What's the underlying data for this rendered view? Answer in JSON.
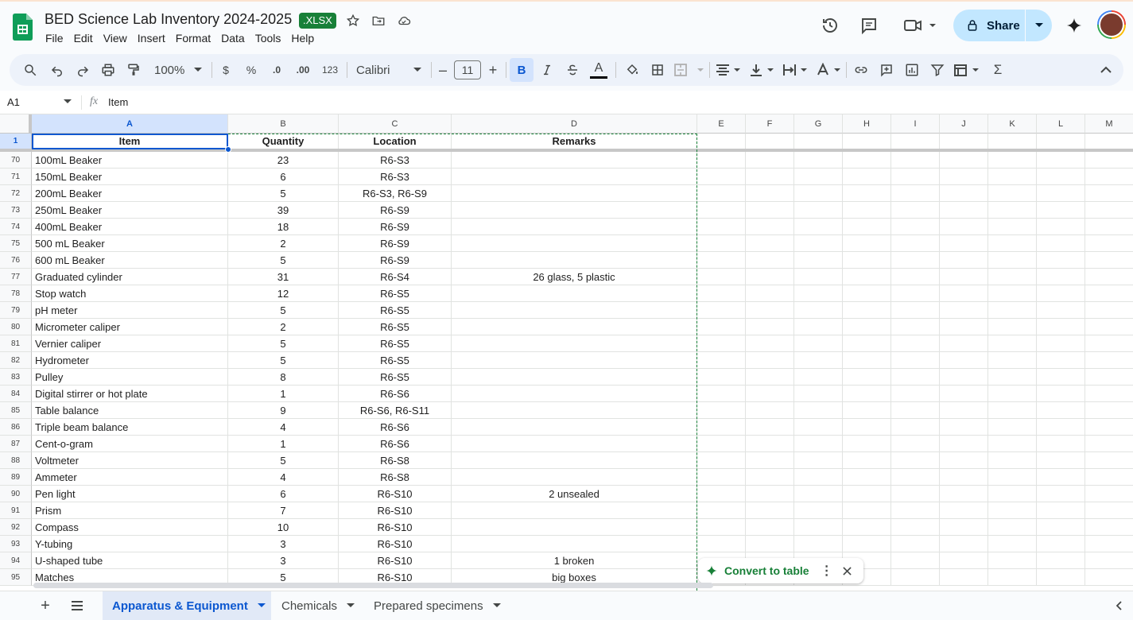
{
  "doc": {
    "title": "BED Science Lab Inventory 2024-2025",
    "badge": ".XLSX"
  },
  "menu": [
    "File",
    "Edit",
    "View",
    "Insert",
    "Format",
    "Data",
    "Tools",
    "Help"
  ],
  "share_label": "Share",
  "toolbar": {
    "zoom": "100%",
    "currency": "$",
    "percent": "%",
    "dec_less": ".0",
    "dec_more": ".00",
    "number_format": "123",
    "font": "Calibri",
    "font_size": "11",
    "bold": "B",
    "text_color": "A"
  },
  "namebox": "A1",
  "formula": "Item",
  "columns": [
    "A",
    "B",
    "C",
    "D",
    "E",
    "F",
    "G",
    "H",
    "I",
    "J",
    "K",
    "L",
    "M"
  ],
  "header_row": {
    "num": "1",
    "cells": [
      "Item",
      "Quantity",
      "Location",
      "Remarks"
    ]
  },
  "rows": [
    {
      "num": "70",
      "item": "100mL Beaker",
      "qty": "23",
      "loc": "R6-S3",
      "rem": ""
    },
    {
      "num": "71",
      "item": "150mL Beaker",
      "qty": "6",
      "loc": "R6-S3",
      "rem": ""
    },
    {
      "num": "72",
      "item": "200mL Beaker",
      "qty": "5",
      "loc": "R6-S3, R6-S9",
      "rem": ""
    },
    {
      "num": "73",
      "item": "250mL Beaker",
      "qty": "39",
      "loc": "R6-S9",
      "rem": ""
    },
    {
      "num": "74",
      "item": "400mL Beaker",
      "qty": "18",
      "loc": "R6-S9",
      "rem": ""
    },
    {
      "num": "75",
      "item": "500 mL Beaker",
      "qty": "2",
      "loc": "R6-S9",
      "rem": ""
    },
    {
      "num": "76",
      "item": "600 mL Beaker",
      "qty": "5",
      "loc": "R6-S9",
      "rem": ""
    },
    {
      "num": "77",
      "item": "Graduated cylinder",
      "qty": "31",
      "loc": "R6-S4",
      "rem": "26 glass, 5 plastic"
    },
    {
      "num": "78",
      "item": "Stop watch",
      "qty": "12",
      "loc": "R6-S5",
      "rem": ""
    },
    {
      "num": "79",
      "item": "pH meter",
      "qty": "5",
      "loc": "R6-S5",
      "rem": ""
    },
    {
      "num": "80",
      "item": "Micrometer caliper",
      "qty": "2",
      "loc": "R6-S5",
      "rem": ""
    },
    {
      "num": "81",
      "item": "Vernier caliper",
      "qty": "5",
      "loc": "R6-S5",
      "rem": ""
    },
    {
      "num": "82",
      "item": "Hydrometer",
      "qty": "5",
      "loc": "R6-S5",
      "rem": ""
    },
    {
      "num": "83",
      "item": "Pulley",
      "qty": "8",
      "loc": "R6-S5",
      "rem": ""
    },
    {
      "num": "84",
      "item": "Digital stirrer or hot plate",
      "qty": "1",
      "loc": "R6-S6",
      "rem": ""
    },
    {
      "num": "85",
      "item": "Table balance",
      "qty": "9",
      "loc": "R6-S6, R6-S11",
      "rem": ""
    },
    {
      "num": "86",
      "item": "Triple beam balance",
      "qty": "4",
      "loc": "R6-S6",
      "rem": ""
    },
    {
      "num": "87",
      "item": "Cent-o-gram",
      "qty": "1",
      "loc": "R6-S6",
      "rem": ""
    },
    {
      "num": "88",
      "item": "Voltmeter",
      "qty": "5",
      "loc": "R6-S8",
      "rem": ""
    },
    {
      "num": "89",
      "item": "Ammeter",
      "qty": "4",
      "loc": "R6-S8",
      "rem": ""
    },
    {
      "num": "90",
      "item": "Pen light",
      "qty": "6",
      "loc": "R6-S10",
      "rem": "2 unsealed"
    },
    {
      "num": "91",
      "item": "Prism",
      "qty": "7",
      "loc": "R6-S10",
      "rem": ""
    },
    {
      "num": "92",
      "item": "Compass",
      "qty": "10",
      "loc": "R6-S10",
      "rem": ""
    },
    {
      "num": "93",
      "item": "Y-tubing",
      "qty": "3",
      "loc": "R6-S10",
      "rem": ""
    },
    {
      "num": "94",
      "item": "U-shaped tube",
      "qty": "3",
      "loc": "R6-S10",
      "rem": "1 broken"
    },
    {
      "num": "95",
      "item": "Matches",
      "qty": "5",
      "loc": "R6-S10",
      "rem": "big boxes"
    }
  ],
  "convert_label": "Convert to table",
  "sheets": [
    "Apparatus & Equipment",
    "Chemicals",
    "Prepared specimens"
  ],
  "colors": {
    "accent": "#0b57d0",
    "green": "#188038",
    "share_bg": "#c2e7ff"
  }
}
